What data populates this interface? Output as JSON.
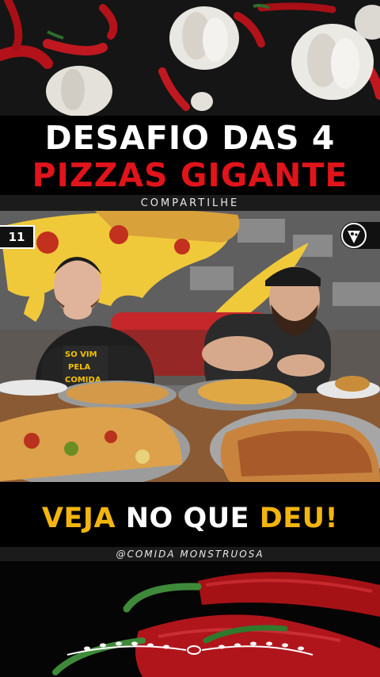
{
  "title": {
    "line1": "DESAFIO DAS 4",
    "line2": "PIZZAS GIGANTE"
  },
  "share_label": "COMPARTILHE",
  "video": {
    "left_badge": "11",
    "right_icon": "pizza-slice-icon",
    "shirt_text_1": "SO VIM",
    "shirt_text_2": "PELA",
    "shirt_text_3": "COMIDA"
  },
  "cta": {
    "part1": "VEJA",
    "part2": " NO QUE ",
    "part3": "DEU!"
  },
  "handle": "@COMIDA MONSTRUOSA",
  "colors": {
    "title_white": "#ffffff",
    "title_red": "#e0141a",
    "cta_yellow": "#f2b50f",
    "background": "#000000"
  }
}
